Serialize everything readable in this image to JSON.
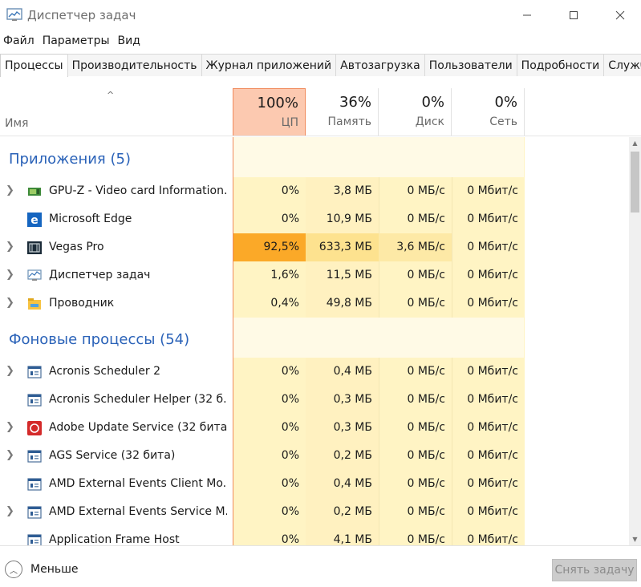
{
  "window": {
    "title": "Диспетчер задач",
    "minimize": "—",
    "maximize": "☐",
    "close": "✕"
  },
  "menu": [
    "Файл",
    "Параметры",
    "Вид"
  ],
  "tabs": [
    {
      "label": "Процессы",
      "active": true
    },
    {
      "label": "Производительность"
    },
    {
      "label": "Журнал приложений"
    },
    {
      "label": "Автозагрузка"
    },
    {
      "label": "Пользователи"
    },
    {
      "label": "Подробности"
    },
    {
      "label": "Службы"
    }
  ],
  "header": {
    "sort_caret": "^",
    "name": "Имя",
    "cpu": {
      "pct": "100%",
      "label": "ЦП"
    },
    "memory": {
      "pct": "36%",
      "label": "Память"
    },
    "disk": {
      "pct": "0%",
      "label": "Диск"
    },
    "network": {
      "pct": "0%",
      "label": "Сеть"
    }
  },
  "groups": {
    "apps": "Приложения (5)",
    "background": "Фоновые процессы (54)"
  },
  "apps": [
    {
      "name": "GPU-Z - Video card Information...",
      "cpu": "0%",
      "mem": "3,8 МБ",
      "disk": "0 МБ/с",
      "net": "0 Мбит/с",
      "icon": "gpuz-icon",
      "expandable": true
    },
    {
      "name": "Microsoft Edge",
      "cpu": "0%",
      "mem": "10,9 МБ",
      "disk": "0 МБ/с",
      "net": "0 Мбит/с",
      "icon": "edge-icon",
      "expandable": false
    },
    {
      "name": "Vegas Pro",
      "cpu": "92,5%",
      "mem": "633,3 МБ",
      "disk": "3,6 МБ/с",
      "net": "0 Мбит/с",
      "icon": "vegas-icon",
      "expandable": true
    },
    {
      "name": "Диспетчер задач",
      "cpu": "1,6%",
      "mem": "11,5 МБ",
      "disk": "0 МБ/с",
      "net": "0 Мбит/с",
      "icon": "taskmgr-icon",
      "expandable": true
    },
    {
      "name": "Проводник",
      "cpu": "0,4%",
      "mem": "49,8 МБ",
      "disk": "0 МБ/с",
      "net": "0 Мбит/с",
      "icon": "explorer-icon",
      "expandable": true
    }
  ],
  "background": [
    {
      "name": "Acronis Scheduler 2",
      "cpu": "0%",
      "mem": "0,4 МБ",
      "disk": "0 МБ/с",
      "net": "0 Мбит/с",
      "icon": "service-icon",
      "expandable": true
    },
    {
      "name": "Acronis Scheduler Helper (32 б...",
      "cpu": "0%",
      "mem": "0,3 МБ",
      "disk": "0 МБ/с",
      "net": "0 Мбит/с",
      "icon": "service-icon",
      "expandable": false
    },
    {
      "name": "Adobe Update Service (32 бита)",
      "cpu": "0%",
      "mem": "0,3 МБ",
      "disk": "0 МБ/с",
      "net": "0 Мбит/с",
      "icon": "adobe-icon",
      "expandable": true
    },
    {
      "name": "AGS Service (32 бита)",
      "cpu": "0%",
      "mem": "0,2 МБ",
      "disk": "0 МБ/с",
      "net": "0 Мбит/с",
      "icon": "service-icon",
      "expandable": true
    },
    {
      "name": "AMD External Events Client Mo...",
      "cpu": "0%",
      "mem": "0,4 МБ",
      "disk": "0 МБ/с",
      "net": "0 Мбит/с",
      "icon": "service-icon",
      "expandable": false
    },
    {
      "name": "AMD External Events Service M...",
      "cpu": "0%",
      "mem": "0,2 МБ",
      "disk": "0 МБ/с",
      "net": "0 Мбит/с",
      "icon": "service-icon",
      "expandable": true
    },
    {
      "name": "Application Frame Host",
      "cpu": "0%",
      "mem": "4,1 МБ",
      "disk": "0 МБ/с",
      "net": "0 Мбит/с",
      "icon": "service-icon",
      "expandable": false
    }
  ],
  "footer": {
    "less": "Меньше",
    "end_task": "Снять задачу"
  }
}
